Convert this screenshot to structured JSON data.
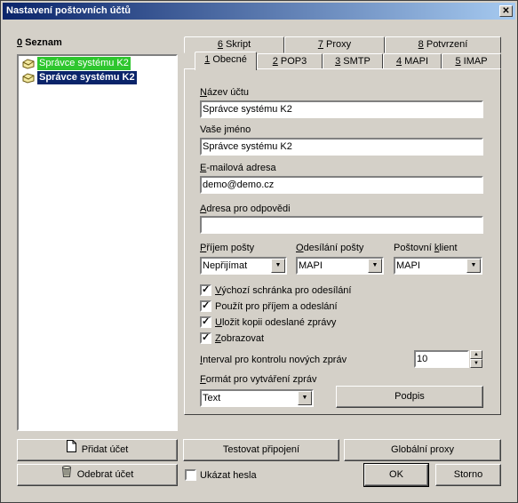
{
  "window": {
    "title": "Nastavení poštovních účtů",
    "close_glyph": "✕"
  },
  "list": {
    "heading_key": "0",
    "heading_rest": " Seznam",
    "items": [
      {
        "label": "Správce systému K2",
        "state": "highlighted-green"
      },
      {
        "label": "Správce systému K2",
        "state": "selected"
      }
    ]
  },
  "tabs_row_back": [
    {
      "key": "6",
      "rest": " Skript"
    },
    {
      "key": "7",
      "rest": " Proxy"
    },
    {
      "key": "8",
      "rest": " Potvrzení"
    }
  ],
  "tabs_row_front": [
    {
      "key": "1",
      "rest": " Obecné",
      "active": true
    },
    {
      "key": "2",
      "rest": " POP3"
    },
    {
      "key": "3",
      "rest": " SMTP"
    },
    {
      "key": "4",
      "rest": " MAPI"
    },
    {
      "key": "5",
      "rest": " IMAP"
    }
  ],
  "form": {
    "account_name_label_key": "N",
    "account_name_label_rest": "ázev účtu",
    "account_name_value": "Správce systému K2",
    "your_name_label_a": "Vaše ",
    "your_name_label_key": "j",
    "your_name_label_rest": "méno",
    "your_name_value": "Správce systému K2",
    "email_label_key": "E",
    "email_label_rest": "-mailová adresa",
    "email_value": "demo@demo.cz",
    "reply_label_key": "A",
    "reply_label_rest": "dresa pro odpovědi",
    "reply_value": "",
    "receive_label_key": "P",
    "receive_label_rest": "říjem pošty",
    "receive_value": "Nepřijímat",
    "send_label_key": "O",
    "send_label_rest": "desílání pošty",
    "send_value": "MAPI",
    "client_label_a": "Poštovní ",
    "client_label_key": "k",
    "client_label_rest": "lient",
    "client_value": "MAPI",
    "checkboxes": [
      {
        "key": "V",
        "rest": "ýchozí schránka pro odesílání",
        "checked": true
      },
      {
        "key": "",
        "rest": "Použít pro příjem a odeslání",
        "checked": true
      },
      {
        "key": "U",
        "rest": "ložit kopii odeslané zprávy",
        "checked": true
      },
      {
        "key": "Z",
        "rest": "obrazovat",
        "checked": true
      }
    ],
    "interval_label_key": "I",
    "interval_label_rest": "nterval pro kontrolu nových zpráv",
    "interval_value": "10",
    "format_label_key": "F",
    "format_label_rest": "ormát pro vytváření zpráv",
    "format_value": "Text",
    "signature_button": "Podpis"
  },
  "buttons": {
    "add_account": "Přidat účet",
    "remove_account": "Odebrat účet",
    "test_connection": "Testovat připojení",
    "global_proxy": "Globální proxy",
    "show_passwords": "Ukázat hesla",
    "ok": "OK",
    "cancel": "Storno"
  },
  "icons": {
    "account": "envelope-icon",
    "add": "document-icon",
    "remove": "trash-icon"
  }
}
